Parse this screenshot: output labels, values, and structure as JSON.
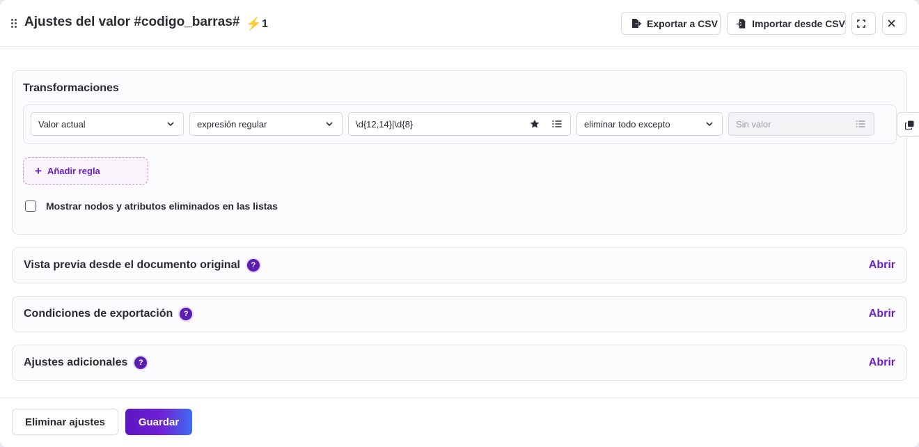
{
  "header": {
    "title": "Ajustes del valor #codigo_barras#",
    "count": "1",
    "export_label": "Exportar a CSV",
    "import_label": "Importar desde CSV"
  },
  "transformations": {
    "title": "Transformaciones",
    "rule": {
      "source": "Valor actual",
      "match_type": "expresión regular",
      "pattern": "\\d{12,14}|\\d{8}",
      "action": "eliminar todo excepto",
      "replacement_placeholder": "Sin valor"
    },
    "add_rule_label": "Añadir regla",
    "checkbox_label": "Mostrar nodos y atributos eliminados en las listas",
    "checkbox_checked": false
  },
  "sections": [
    {
      "title": "Vista previa desde el documento original",
      "action": "Abrir"
    },
    {
      "title": "Condiciones de exportación",
      "action": "Abrir"
    },
    {
      "title": "Ajustes adicionales",
      "action": "Abrir"
    }
  ],
  "footer": {
    "delete_label": "Eliminar ajustes",
    "save_label": "Guardar"
  },
  "colors": {
    "accent": "#6a1fc4",
    "bolt": "#f5b300"
  }
}
